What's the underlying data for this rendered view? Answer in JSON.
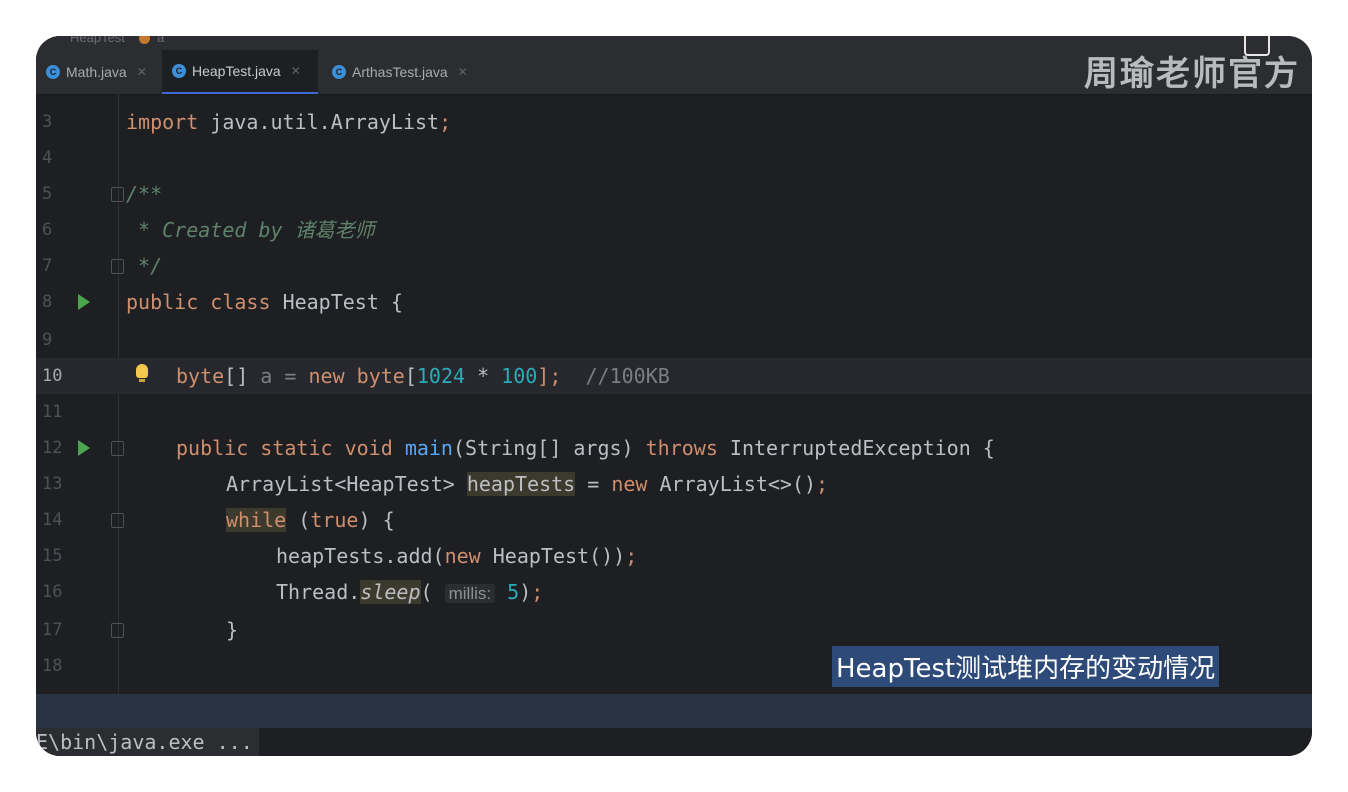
{
  "breadcrumb": {
    "project": "HeapTest",
    "item": "a"
  },
  "tabs": [
    {
      "label": "Math.java",
      "active": false
    },
    {
      "label": "HeapTest.java",
      "active": true
    },
    {
      "label": "ArthasTest.java",
      "active": false
    }
  ],
  "watermark": "周瑜老师官方",
  "code": {
    "lines": {
      "l3": {
        "num": "3",
        "kw": "import",
        "rest": " java.util.ArrayList",
        "semi": ";"
      },
      "l4": {
        "num": "4"
      },
      "l5": {
        "num": "5",
        "text": "/**"
      },
      "l6": {
        "num": "6",
        "text": " * Created by 诸葛老师"
      },
      "l7": {
        "num": "7",
        "text": " */"
      },
      "l8": {
        "num": "8",
        "kw1": "public",
        "kw2": "class",
        "name": "HeapTest",
        "brace": " {"
      },
      "l9": {
        "num": "9"
      },
      "l10": {
        "num": "10",
        "type": "byte",
        "arr": "[]",
        "var": " a = ",
        "newkw": "new",
        "type2": "byte",
        "open": "[",
        "n1": "1024",
        "op": " * ",
        "n2": "100",
        "close": "];",
        "comment": "//100KB"
      },
      "l11": {
        "num": "11"
      },
      "l12": {
        "num": "12",
        "k1": "public",
        "k2": "static",
        "k3": "void",
        "fn": "main",
        "params": "(String[] args) ",
        "k4": "throws",
        "ex": " InterruptedException {"
      },
      "l13": {
        "num": "13",
        "t": "ArrayList<HeapTest> ",
        "v": "heapTests",
        "eq": " = ",
        "newkw": "new",
        "rest": " ArrayList<>()",
        "semi": ";"
      },
      "l14": {
        "num": "14",
        "kw": "while",
        "cond1": " (",
        "tru": "true",
        "cond2": ") {"
      },
      "l15": {
        "num": "15",
        "call": "heapTests.add(",
        "newkw": "new",
        "rest": " HeapTest())",
        "semi": ";"
      },
      "l16": {
        "num": "16",
        "obj": "Thread.",
        "fn": "sleep",
        "open": "(",
        "hint": "millis:",
        "val": "5",
        "close": ")",
        "semi": ";"
      },
      "l17": {
        "num": "17",
        "text": "}"
      },
      "l18": {
        "num": "18"
      }
    }
  },
  "subtitle": "HeapTest测试堆内存的变动情况",
  "console": {
    "text": "E\\bin\\java.exe ..."
  }
}
